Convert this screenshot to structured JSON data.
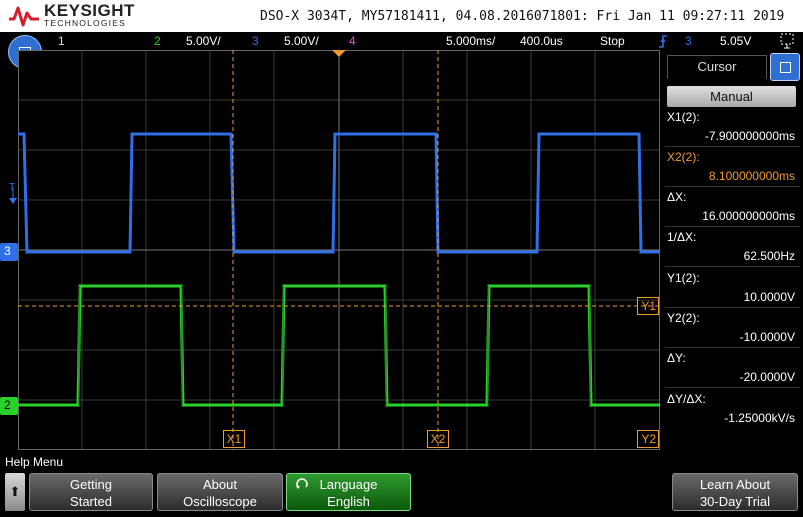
{
  "header": {
    "brand_name": "KEYSIGHT",
    "brand_sub": "TECHNOLOGIES",
    "info": "DSO-X 3034T, MY57181411, 04.08.2016071801: Fri Jan 11 09:27:11 2019"
  },
  "status": {
    "ch1_num": "1",
    "ch2_num": "2",
    "ch2_scale": "5.00V/",
    "ch3_num": "3",
    "ch3_scale": "5.00V/",
    "ch4_num": "4",
    "timebase": "5.000ms/",
    "delay": "400.0us",
    "run_state": "Stop",
    "trigger_icon": "trigger-rising-edge-icon",
    "trigger_source": "3",
    "trigger_level": "5.05V"
  },
  "colors": {
    "ch2": "#2bd12b",
    "ch3": "#2f6fe8",
    "ch4": "#e050e0",
    "cursor": "#f09a30"
  },
  "markers": {
    "x1": "X1",
    "x2": "X2",
    "y1": "Y1",
    "y2": "Y2",
    "t": "T",
    "ch3": "3",
    "ch2": "2"
  },
  "cursor_panel": {
    "tab": "Cursor",
    "mode": "Manual",
    "x1_label": "X1(2):",
    "x1_value": "-7.900000000ms",
    "x2_label": "X2(2):",
    "x2_value": "8.100000000ms",
    "dx_label": "ΔX:",
    "dx_value": "16.000000000ms",
    "inv_dx_label": "1/ΔX:",
    "inv_dx_value": "62.500Hz",
    "y1_label": "Y1(2):",
    "y1_value": "10.0000V",
    "y2_label": "Y2(2):",
    "y2_value": "-10.0000V",
    "dy_label": "ΔY:",
    "dy_value": "-20.0000V",
    "dydx_label": "ΔY/ΔX:",
    "dydx_value": "-1.25000kV/s"
  },
  "help_menu": {
    "title": "Help Menu",
    "up_arrow": "⬆",
    "getting_started_l1": "Getting",
    "getting_started_l2": "Started",
    "about_l1": "About",
    "about_l2": "Oscilloscope",
    "language_l1": "Language",
    "language_l2": "English",
    "trial_l1": "Learn About",
    "trial_l2": "30-Day Trial"
  }
}
